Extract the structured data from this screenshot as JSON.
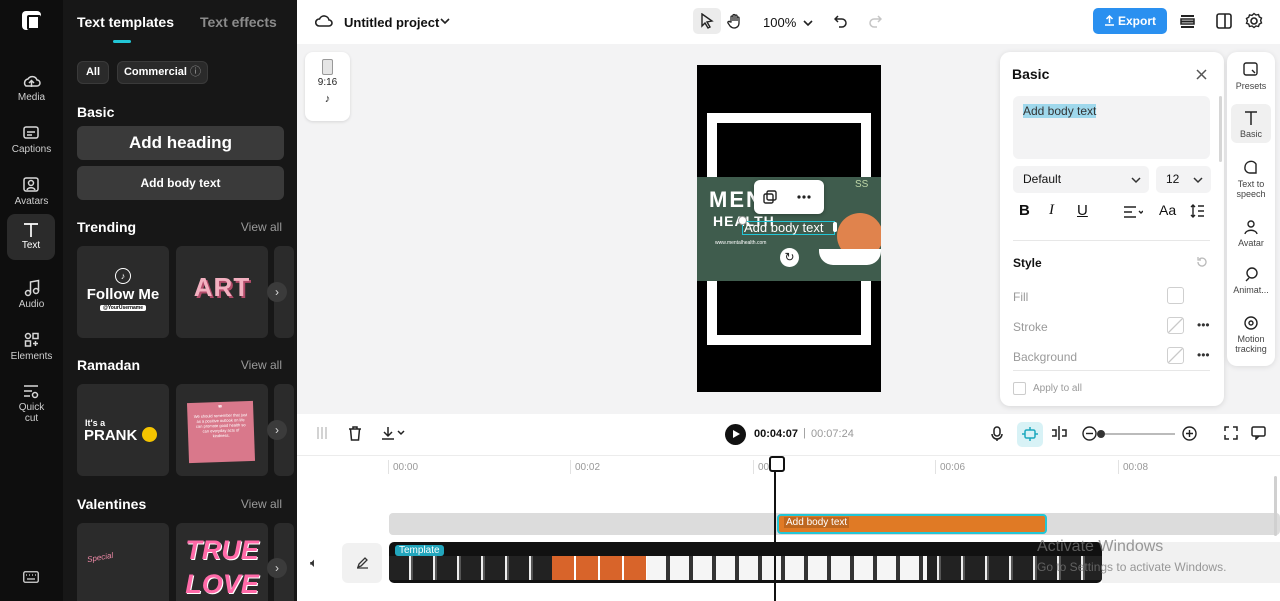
{
  "nav": {
    "items": [
      {
        "label": "Media",
        "icon": "media-icon"
      },
      {
        "label": "Captions",
        "icon": "captions-icon"
      },
      {
        "label": "Avatars",
        "icon": "avatars-icon"
      },
      {
        "label": "Text",
        "icon": "text-icon"
      },
      {
        "label": "Audio",
        "icon": "audio-icon"
      },
      {
        "label": "Elements",
        "icon": "elements-icon"
      },
      {
        "label": "Quick",
        "label2": "cut",
        "icon": "quick-cut-icon"
      }
    ]
  },
  "panel": {
    "tab1": "Text templates",
    "tab2": "Text effects",
    "filter_all": "All",
    "filter_commercial": "Commercial",
    "basic_heading": "Basic",
    "add_heading": "Add heading",
    "add_body": "Add body text",
    "sections": [
      {
        "title": "Trending",
        "view_all": "View all"
      },
      {
        "title": "Ramadan",
        "view_all": "View all"
      },
      {
        "title": "Valentines",
        "view_all": "View all"
      }
    ],
    "thumbs": {
      "follow_me": "Follow Me",
      "username": "@YourUsername",
      "art": "ART",
      "its_a": "It's a",
      "prank": "PRANK",
      "ramadan_quote": "We should remember that just as a positive outlook on life can promote good health so can everyday acts of kindness.",
      "special": "Special",
      "true_love_1": "TRUE",
      "true_love_2": "LOVE"
    }
  },
  "topbar": {
    "project_title": "Untitled project",
    "zoom": "100%",
    "export": "Export"
  },
  "canvas": {
    "ratio": "9:16",
    "overlay_text": "Add body text",
    "banner_line1": "MENTAL",
    "banner_line2": "HEALTH",
    "banner_url": "www.mentalhealth.com",
    "banner_corner": "SS"
  },
  "props": {
    "title": "Basic",
    "text_value": "Add body text",
    "font": "Default",
    "font_size": "12",
    "style_heading": "Style",
    "fill": "Fill",
    "stroke": "Stroke",
    "background": "Background",
    "apply_all": "Apply to all"
  },
  "rtools": [
    {
      "label": "Presets",
      "icon": "presets-icon"
    },
    {
      "label": "Basic",
      "icon": "basic-text-icon"
    },
    {
      "label": "Text to",
      "label2": "speech",
      "icon": "text-to-speech-icon"
    },
    {
      "label": "Avatar",
      "icon": "avatar-icon"
    },
    {
      "label": "Animat...",
      "icon": "animation-icon"
    },
    {
      "label": "Motion",
      "label2": "tracking",
      "icon": "motion-tracking-icon"
    }
  ],
  "playback": {
    "current": "00:04:07",
    "separator": "|",
    "total": "00:07:24"
  },
  "timeline": {
    "ruler": [
      "00:00",
      "00:02",
      "00:04",
      "00:06",
      "00:08"
    ],
    "text_clip": "Add body text",
    "template_tag": "Template",
    "watermark_1": "Activate Windows",
    "watermark_2": "Go to Settings to activate Windows."
  },
  "colors": {
    "accent": "#22c6d6",
    "export": "#2a90f0",
    "clip_orange": "#e07a25",
    "dark_bg": "#171717"
  }
}
